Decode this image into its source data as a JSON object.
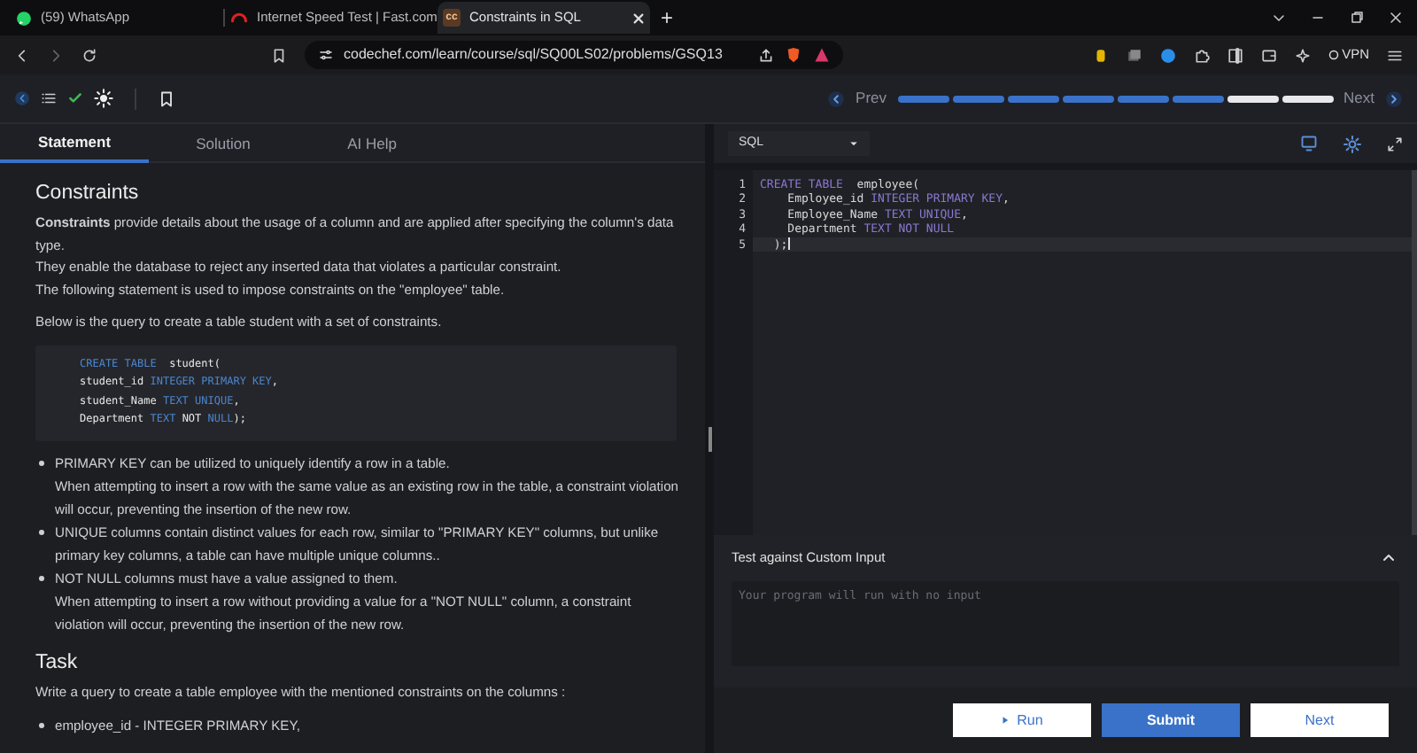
{
  "browser_tabs": [
    {
      "title": "(59) WhatsApp",
      "selected": false,
      "kind": "whatsapp"
    },
    {
      "title": "Internet Speed Test | Fast.com",
      "selected": false,
      "kind": "speed"
    },
    {
      "title": "Constraints in SQL",
      "selected": true,
      "kind": "site",
      "favicon_text": "cc"
    }
  ],
  "new_tab": "+",
  "address": "codechef.com/learn/course/sql/SQ00LS02/problems/GSQ13",
  "vpn": "VPN",
  "toolbar": {
    "prev": "Prev",
    "next": "Next",
    "progress": [
      {
        "done": true
      },
      {
        "done": true
      },
      {
        "done": true
      },
      {
        "done": true
      },
      {
        "done": true
      },
      {
        "done": true
      },
      {
        "done": false
      },
      {
        "done": false
      }
    ]
  },
  "panel_tabs": [
    {
      "label": "Statement",
      "selected": true
    },
    {
      "label": "Solution",
      "selected": false
    },
    {
      "label": "AI Help",
      "selected": false
    }
  ],
  "language": "SQL",
  "statement": [
    {
      "kind": "heading",
      "text": "Constraints"
    },
    {
      "kind": "paragraph",
      "lines": [
        "**Constraints** provide details about the usage of a column and are applied after specifying the column's data type.",
        "They enable the database to reject any inserted data that violates a particular constraint.",
        "The following statement is used to impose constraints on the \"employee\" table."
      ]
    },
    {
      "kind": "paragraph",
      "lines": [
        "Below is the query to create a table student with a set of constraints."
      ]
    },
    {
      "kind": "code",
      "lines": [
        [
          {
            "text": "CREATE TABLE",
            "kind": "keyword"
          },
          {
            "text": "  student(",
            "kind": "plain"
          }
        ],
        [
          {
            "text": "student_id ",
            "kind": "plain"
          },
          {
            "text": "INTEGER PRIMARY KEY",
            "kind": "keyword"
          },
          {
            "text": ",",
            "kind": "plain"
          }
        ],
        [
          {
            "text": "student_Name ",
            "kind": "plain"
          },
          {
            "text": "TEXT UNIQUE",
            "kind": "keyword"
          },
          {
            "text": ",",
            "kind": "plain"
          }
        ],
        [
          {
            "text": "Department ",
            "kind": "plain"
          },
          {
            "text": "TEXT",
            "kind": "keyword"
          },
          {
            "text": " NOT ",
            "kind": "plain"
          },
          {
            "text": "NULL",
            "kind": "keyword"
          },
          {
            "text": ");",
            "kind": "plain"
          }
        ]
      ]
    },
    {
      "kind": "bullets",
      "items": [
        {
          "lines": [
            "PRIMARY KEY can be utilized to uniquely identify a row in a table.",
            "When attempting to insert a row with the same value as an existing row in the table, a constraint violation will occur, preventing the insertion of the new row."
          ]
        },
        {
          "lines": [
            "UNIQUE columns contain distinct values for each row, similar to \"PRIMARY KEY\" columns, but unlike primary key columns, a table can have multiple unique columns.."
          ]
        },
        {
          "lines": [
            "NOT NULL columns must have a value assigned to them.",
            "When attempting to insert a row without providing a value for a \"NOT NULL\" column, a constraint violation will occur, preventing the insertion of the new row."
          ]
        }
      ]
    },
    {
      "kind": "heading",
      "text": "Task"
    },
    {
      "kind": "paragraph",
      "lines": [
        "Write a query to create a table employee with the mentioned constraints on the columns :"
      ]
    },
    {
      "kind": "bullets",
      "items": [
        {
          "lines": [
            "employee_id - INTEGER PRIMARY KEY,"
          ]
        }
      ]
    }
  ],
  "editor": {
    "lines": [
      {
        "number": "1",
        "tokens": [
          {
            "text": "CREATE TABLE",
            "kind": "keyword"
          },
          {
            "text": "  employee(",
            "kind": "plain"
          }
        ]
      },
      {
        "number": "2",
        "tokens": [
          {
            "text": "    Employee_id ",
            "kind": "plain"
          },
          {
            "text": "INTEGER PRIMARY KEY",
            "kind": "keyword"
          },
          {
            "text": ",",
            "kind": "plain"
          }
        ]
      },
      {
        "number": "3",
        "tokens": [
          {
            "text": "    Employee_Name ",
            "kind": "plain"
          },
          {
            "text": "TEXT UNIQUE",
            "kind": "keyword"
          },
          {
            "text": ",",
            "kind": "plain"
          }
        ]
      },
      {
        "number": "4",
        "tokens": [
          {
            "text": "    Department ",
            "kind": "plain"
          },
          {
            "text": "TEXT NOT NULL",
            "kind": "keyword"
          }
        ]
      },
      {
        "number": "5",
        "current": true,
        "tokens": [
          {
            "text": "  );",
            "kind": "plain"
          }
        ]
      }
    ]
  },
  "custom_input": {
    "title": "Test against Custom Input",
    "placeholder": "Your program will run with no input"
  },
  "buttons": [
    {
      "label": "Run",
      "kind": "run"
    },
    {
      "label": "Submit",
      "kind": "submit"
    },
    {
      "label": "Next",
      "kind": "next"
    }
  ]
}
